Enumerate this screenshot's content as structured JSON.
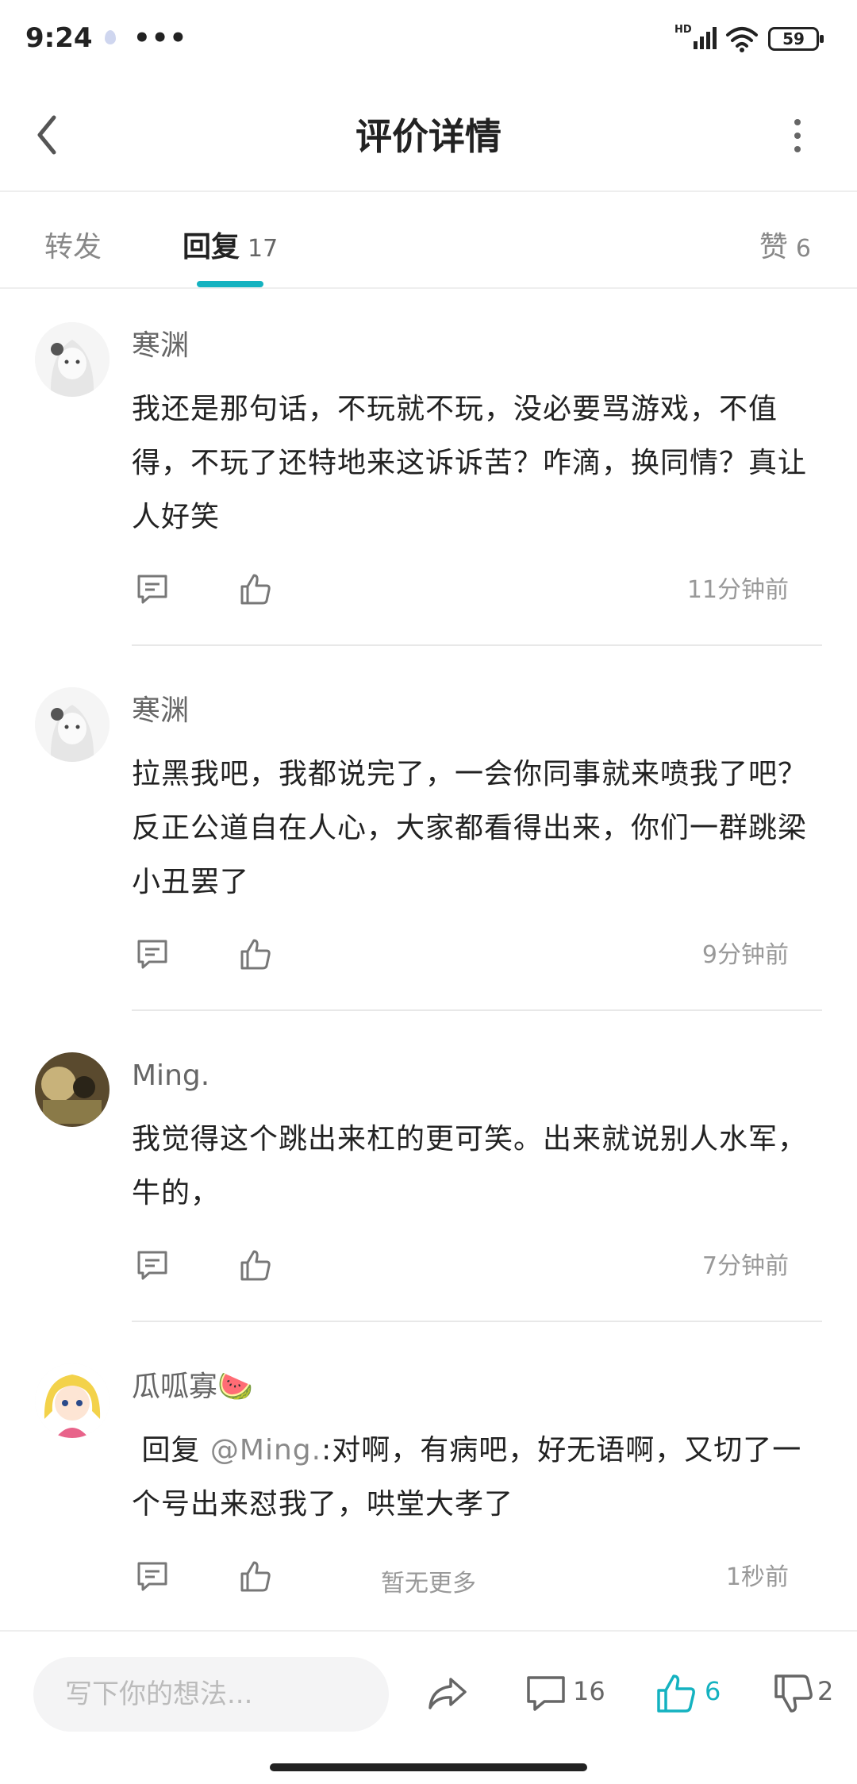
{
  "status": {
    "time": "9:24",
    "dots": "•••",
    "hd": "HD",
    "battery": "59"
  },
  "nav": {
    "title": "评价详情"
  },
  "tabs": {
    "forward": "转发",
    "reply": "回复",
    "reply_count": "17",
    "like": "赞",
    "like_count": "6"
  },
  "comments": [
    {
      "user": "寒渊",
      "text": "我还是那句话，不玩就不玩，没必要骂游戏，不值得，不玩了还特地来这诉诉苦？咋滴，换同情？真让人好笑",
      "time": "11分钟前"
    },
    {
      "user": "寒渊",
      "text": "拉黑我吧，我都说完了，一会你同事就来喷我了吧？反正公道自在人心，大家都看得出来，你们一群跳梁小丑罢了",
      "time": "9分钟前"
    },
    {
      "user": "Ming.",
      "text": "我觉得这个跳出来杠的更可笑。出来就说别人水军，牛的，",
      "time": "7分钟前"
    },
    {
      "user": "瓜呱寡🍉",
      "reply_prefix": " 回复 ",
      "mention": "@Ming.",
      "text": ":对啊，有病吧，好无语啊，又切了一个号出来怼我了，哄堂大孝了",
      "time": "1秒前"
    }
  ],
  "nomore": "暂无更多",
  "bottom": {
    "placeholder": "写下你的想法...",
    "comment_count": "16",
    "like_count": "6",
    "dislike_count": "2"
  },
  "colors": {
    "accent": "#14b2c0",
    "muted": "#999999",
    "text": "#222222"
  }
}
